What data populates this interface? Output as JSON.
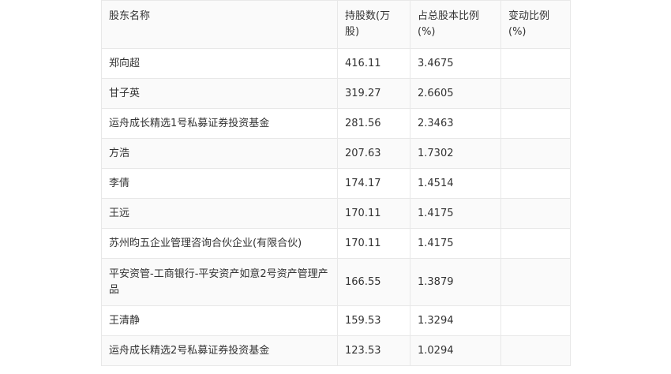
{
  "table": {
    "headers": [
      "股东名称",
      "持股数(万股)",
      "占总股本比例(%)",
      "变动比例(%)"
    ],
    "rows": [
      [
        "郑向超",
        "416.11",
        "3.4675",
        ""
      ],
      [
        "甘子英",
        "319.27",
        "2.6605",
        ""
      ],
      [
        "运舟成长精选1号私募证券投资基金",
        "281.56",
        "2.3463",
        ""
      ],
      [
        "方浩",
        "207.63",
        "1.7302",
        ""
      ],
      [
        "李倩",
        "174.17",
        "1.4514",
        ""
      ],
      [
        "王远",
        "170.11",
        "1.4175",
        ""
      ],
      [
        "苏州昀五企业管理咨询合伙企业(有限合伙)",
        "170.11",
        "1.4175",
        ""
      ],
      [
        "平安资管-工商银行-平安资产如意2号资产管理产品",
        "166.55",
        "1.3879",
        ""
      ],
      [
        "王清静",
        "159.53",
        "1.3294",
        ""
      ],
      [
        "运舟成长精选2号私募证券投资基金",
        "123.53",
        "1.0294",
        ""
      ]
    ]
  }
}
